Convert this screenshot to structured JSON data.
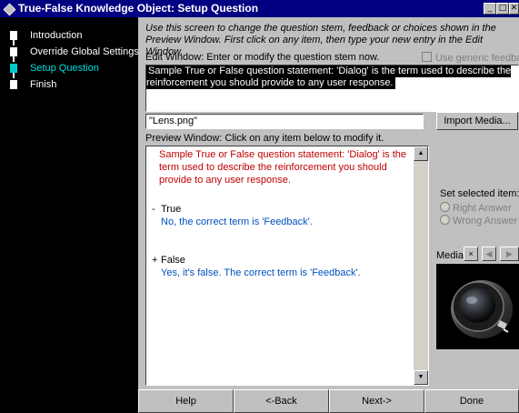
{
  "window": {
    "title": "True-False Knowledge Object: Setup Question",
    "minimize_glyph": "_",
    "maximize_glyph": "□",
    "close_glyph": "✕"
  },
  "steps": [
    {
      "label": "Introduction",
      "active": false
    },
    {
      "label": "Override Global Settings",
      "active": false
    },
    {
      "label": "Setup Question",
      "active": true
    },
    {
      "label": "Finish",
      "active": false
    }
  ],
  "instructions": "Use this screen to change the question stem, feedback or choices shown in the Preview Window. First click on any item, then type your new entry in the Edit Window.",
  "edit_window": {
    "label": "Edit Window: Enter or modify the question stem now.",
    "generic_feedback_label": "Use generic feedback",
    "value": "Sample True or False question statement: 'Dialog' is the term used to describe the reinforcement you should provide to any user response."
  },
  "media": {
    "filename": "\"Lens.png\"",
    "import_label": "Import Media...",
    "label": "Media:",
    "buttons": [
      "×",
      "◀",
      "▶"
    ]
  },
  "preview": {
    "label": "Preview Window: Click on any item below to modify it.",
    "stem": "Sample True or False question statement: 'Dialog' is the term used to describe the reinforcement you should provide to any user response.",
    "choices": [
      {
        "symbol": "-",
        "text": "True",
        "feedback": "No, the correct term is 'Feedback'."
      },
      {
        "symbol": "+",
        "text": "False",
        "feedback": "Yes, it's false. The correct term is 'Feedback'."
      }
    ]
  },
  "set_selected": {
    "label": "Set selected item:",
    "options": [
      "Right Answer",
      "Wrong Answer"
    ]
  },
  "nav": {
    "help": "Help",
    "back": "<-Back",
    "next": "Next->",
    "done": "Done"
  },
  "colors": {
    "title_bar": "#000080",
    "active_step": "#00c8c8",
    "stem_text": "#c00000",
    "feedback_text": "#0050c0"
  }
}
